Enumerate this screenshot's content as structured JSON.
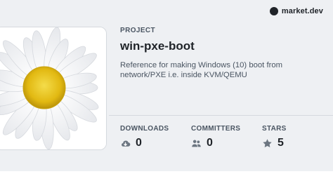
{
  "brand": {
    "name": "market.dev"
  },
  "project": {
    "section_label": "PROJECT",
    "title": "win-pxe-boot",
    "description": "Reference for making Windows (10) boot from network/PXE i.e. inside KVM/QEMU"
  },
  "stats": [
    {
      "label": "DOWNLOADS",
      "value": "0",
      "icon": "cloud-download-icon"
    },
    {
      "label": "COMMITTERS",
      "value": "0",
      "icon": "users-icon"
    },
    {
      "label": "STARS",
      "value": "5",
      "icon": "star-icon"
    }
  ],
  "colors": {
    "background": "#eef0f3",
    "text_primary": "#1f2328",
    "text_secondary": "#4a5562",
    "icon": "#6b7580",
    "daisy_center": "#e8c21a"
  }
}
